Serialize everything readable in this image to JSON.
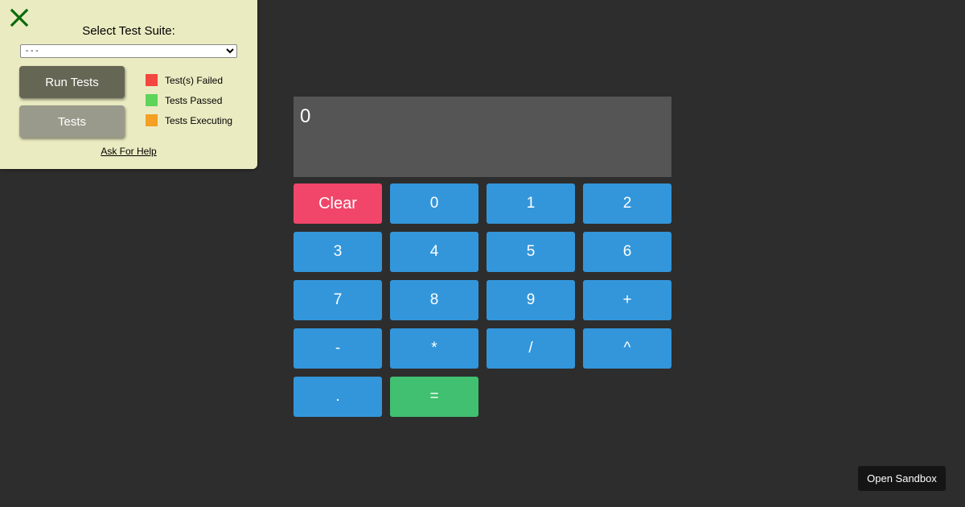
{
  "test_panel": {
    "title": "Select Test Suite:",
    "suite_select_value": "- - -",
    "run_button": "Run Tests",
    "tests_button": "Tests",
    "legend": [
      {
        "label": "Test(s) Failed",
        "color": "#f2483f"
      },
      {
        "label": "Tests Passed",
        "color": "#5ed45a"
      },
      {
        "label": "Tests Executing",
        "color": "#f3a024"
      }
    ],
    "help_link": "Ask For Help",
    "close_color": "#0a6b0a"
  },
  "calculator": {
    "display": "0",
    "keys": {
      "clear": "Clear",
      "k0": "0",
      "k1": "1",
      "k2": "2",
      "k3": "3",
      "k4": "4",
      "k5": "5",
      "k6": "6",
      "k7": "7",
      "k8": "8",
      "k9": "9",
      "plus": "+",
      "minus": "-",
      "multiply": "*",
      "divide": "/",
      "power": "^",
      "decimal": ".",
      "equals": "="
    },
    "colors": {
      "number_key": "#3396db",
      "clear_key": "#f1466a",
      "equals_key": "#40c070",
      "display_bg": "#555555"
    }
  },
  "sandbox_button": "Open Sandbox"
}
